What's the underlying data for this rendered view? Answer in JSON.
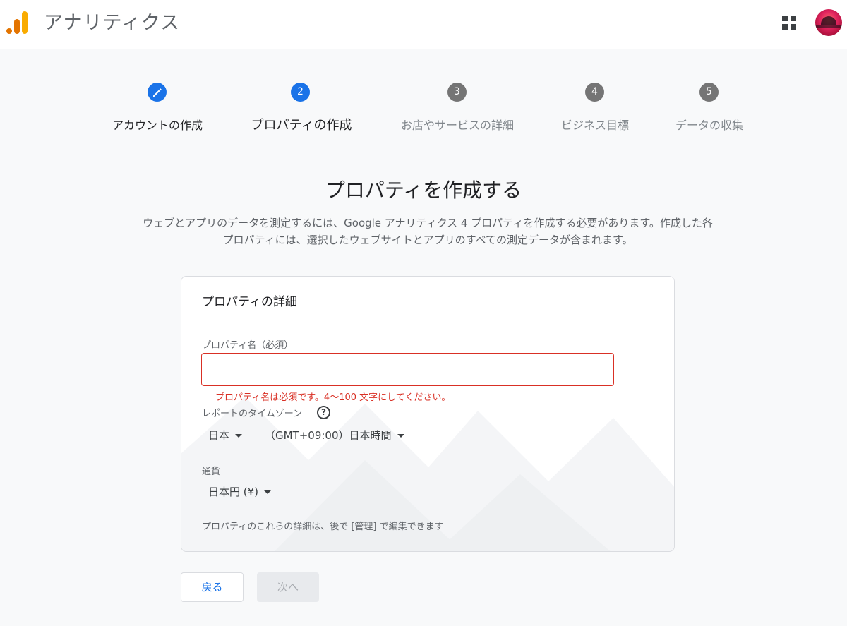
{
  "header": {
    "app_title": "アナリティクス",
    "logo_icon": "analytics-logo-icon",
    "apps_icon": "apps-grid-icon",
    "brand_colors": {
      "orange": "#f9ab00",
      "dark_orange": "#e37400"
    }
  },
  "stepper": {
    "steps": [
      {
        "number": "",
        "label": "アカウントの作成",
        "state": "done",
        "icon": "pencil-icon"
      },
      {
        "number": "2",
        "label": "プロパティの作成",
        "state": "current"
      },
      {
        "number": "3",
        "label": "お店やサービスの詳細",
        "state": "future"
      },
      {
        "number": "4",
        "label": "ビジネス目標",
        "state": "future"
      },
      {
        "number": "5",
        "label": "データの収集",
        "state": "future"
      }
    ],
    "active_color": "#1a73e8",
    "inactive_color": "#757575"
  },
  "page": {
    "title": "プロパティを作成する",
    "description_line1": "ウェブとアプリのデータを測定するには、Google アナリティクス 4 プロパティを作成する必要があります。作成した各",
    "description_line2": "プロパティには、選択したウェブサイトとアプリのすべての測定データが含まれます。"
  },
  "card": {
    "title": "プロパティの詳細",
    "property_name": {
      "label": "プロパティ名（必須）",
      "value": "",
      "error": "プロパティ名は必須です。4〜100 文字にしてください。",
      "error_color": "#d93025"
    },
    "timezone": {
      "label": "レポートのタイムゾーン",
      "help_icon": "help-circle-icon",
      "country": "日本",
      "zone": "（GMT+09:00）日本時間"
    },
    "currency": {
      "label": "通貨",
      "value": "日本円 (¥)"
    },
    "footnote": "プロパティのこれらの詳細は、後で [管理] で編集できます"
  },
  "actions": {
    "back_label": "戻る",
    "next_label": "次へ"
  }
}
